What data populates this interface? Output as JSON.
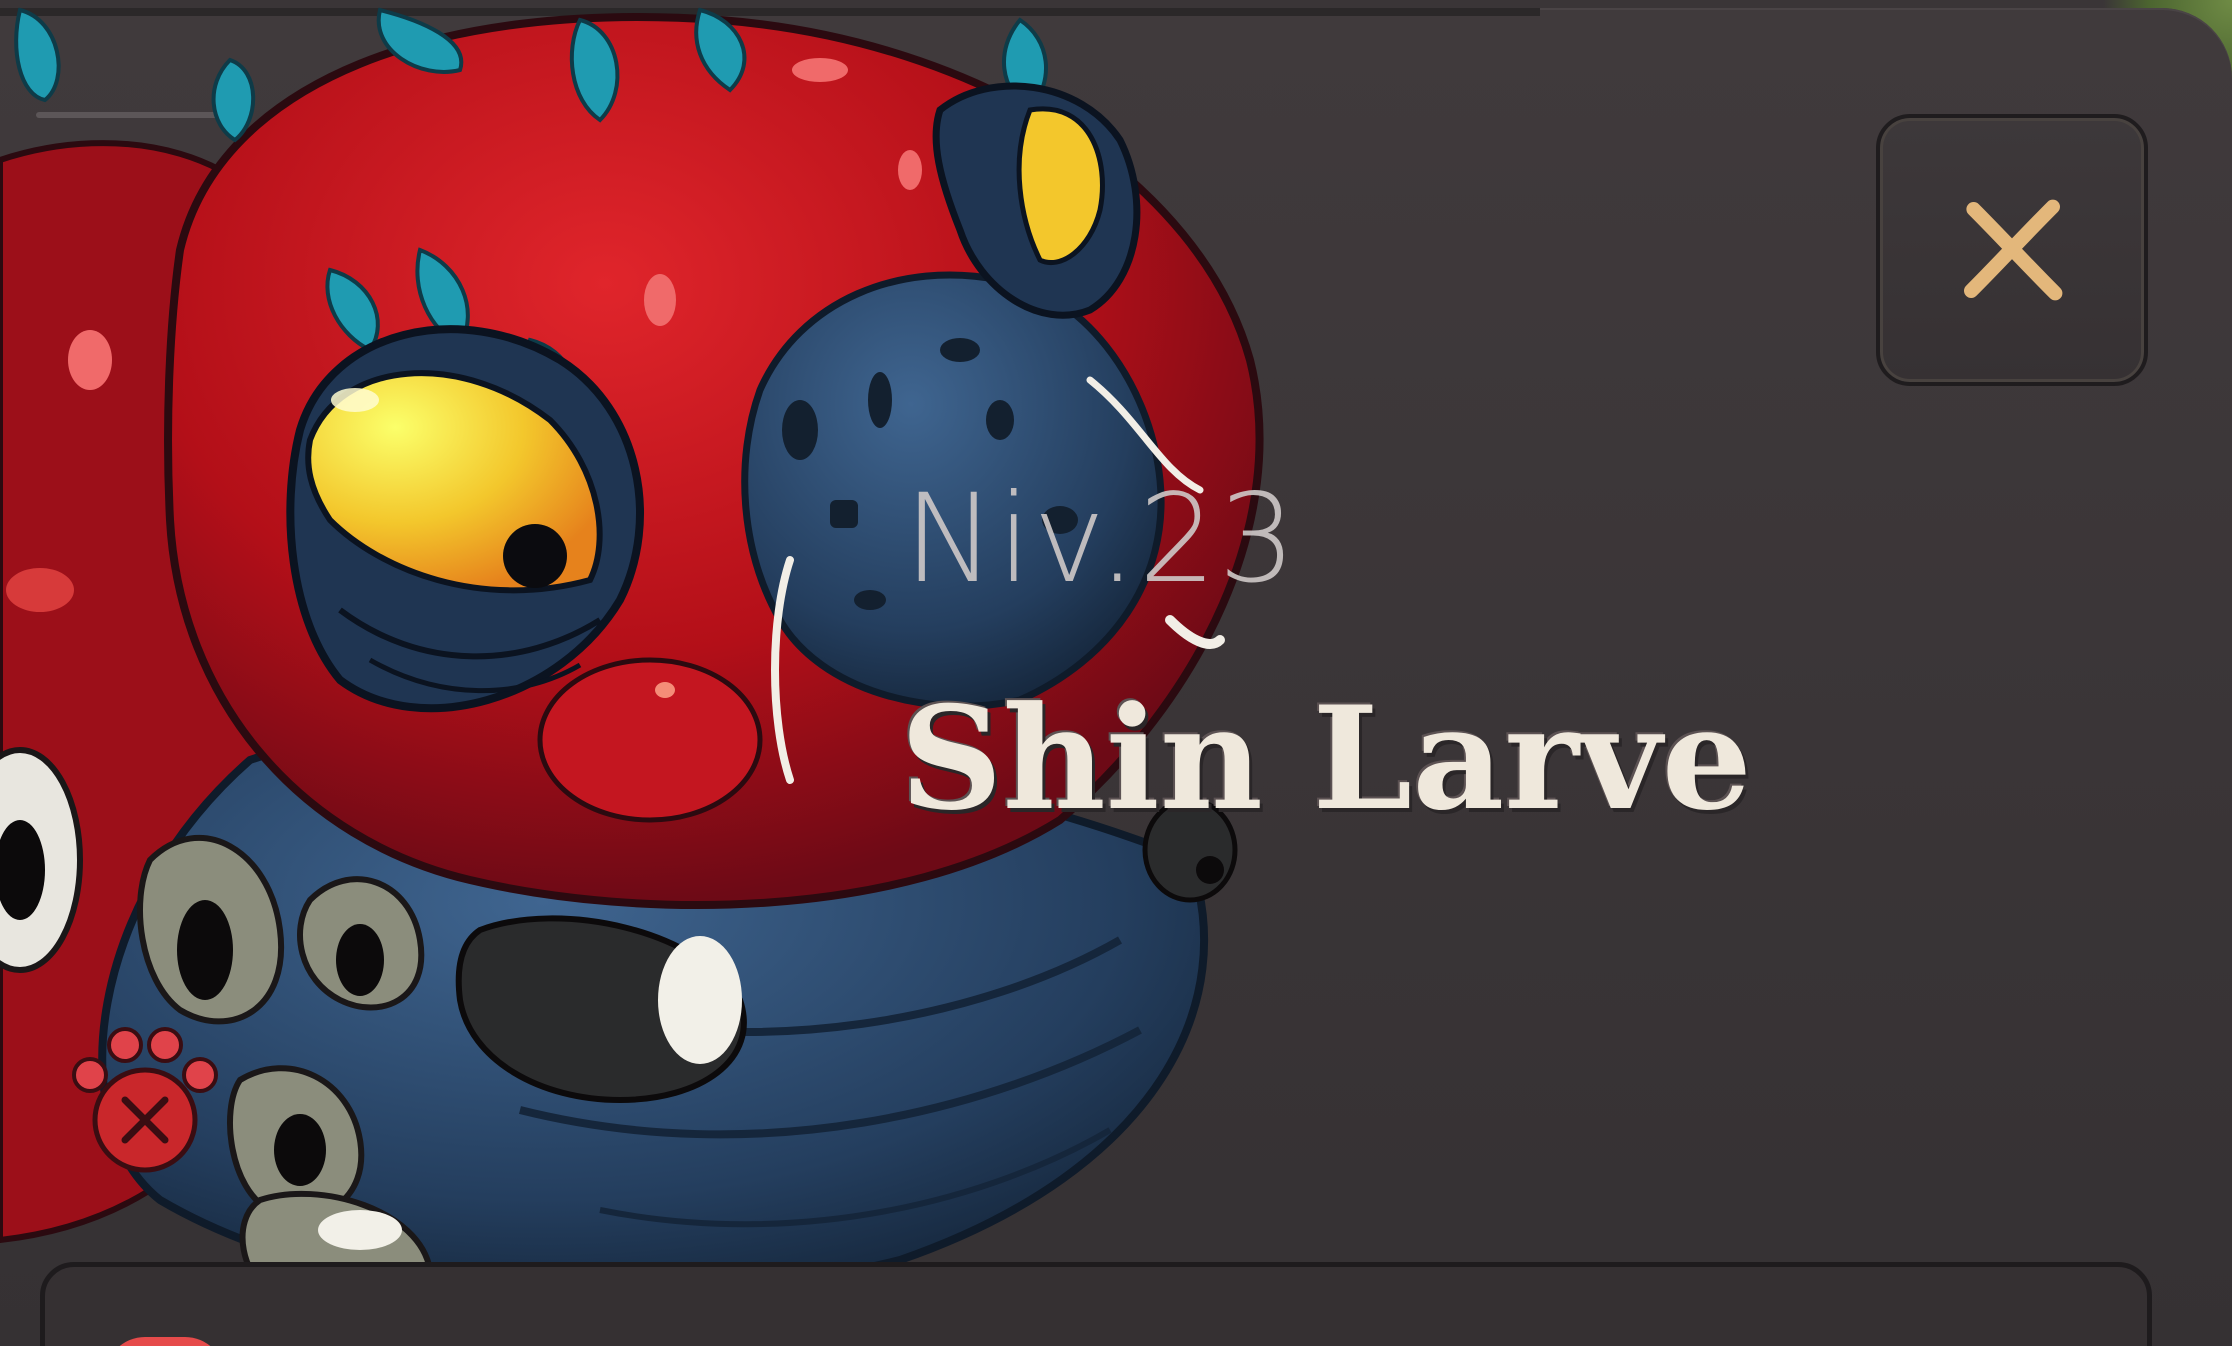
{
  "creature": {
    "level": "Niv.23",
    "name": "Shin Larve"
  },
  "close_button": {
    "icon": "close-icon"
  },
  "colors": {
    "panel": "#3a3537",
    "close_x": "#e3b77b",
    "creature_red": "#c8141a",
    "creature_blue": "#2c4a6b",
    "eye_yellow": "#f5d43a",
    "name_text": "#efe8dc",
    "level_text": "#cfc9c8"
  }
}
